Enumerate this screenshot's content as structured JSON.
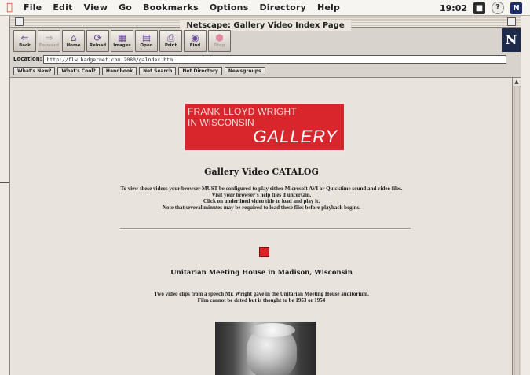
{
  "menubar": {
    "items": [
      "File",
      "Edit",
      "View",
      "Go",
      "Bookmarks",
      "Options",
      "Directory",
      "Help"
    ],
    "clock": "19:02"
  },
  "window": {
    "title": "Netscape: Gallery Video Index Page"
  },
  "toolbar": {
    "buttons": [
      {
        "label": "Back"
      },
      {
        "label": "Forward"
      },
      {
        "label": "Home"
      },
      {
        "label": "Reload"
      },
      {
        "label": "Images"
      },
      {
        "label": "Open"
      },
      {
        "label": "Print"
      },
      {
        "label": "Find"
      },
      {
        "label": "Stop"
      }
    ],
    "logo": "N"
  },
  "location": {
    "label": "Location:",
    "url": "http://flw.badgernet.com:2080/galndex.htm"
  },
  "directory_buttons": [
    "What's New?",
    "What's Cool?",
    "Handbook",
    "Net Search",
    "Net Directory",
    "Newsgroups"
  ],
  "page": {
    "banner": {
      "line1": "FRANK LLOYD WRIGHT",
      "line2": "IN WISCONSIN",
      "line3": "GALLERY"
    },
    "heading": "Gallery Video CATALOG",
    "intro_lines": [
      "To view these videos your browser MUST be configured to play either Microsoft AVI or Quicktime sound and video files.",
      "Visit your browser's help files if uncertain.",
      "Click on underlined video title to load and play it.",
      "Note that several minutes may be required to load these files before playback begins."
    ],
    "video_title": "Unitarian Meeting House in Madison, Wisconsin",
    "video_desc_lines": [
      "Two video clips from a speech Mr. Wright gave in the Unitarian Meeting House auditorium.",
      "Film cannot be dated but is thought to be 1953 or 1954"
    ]
  }
}
